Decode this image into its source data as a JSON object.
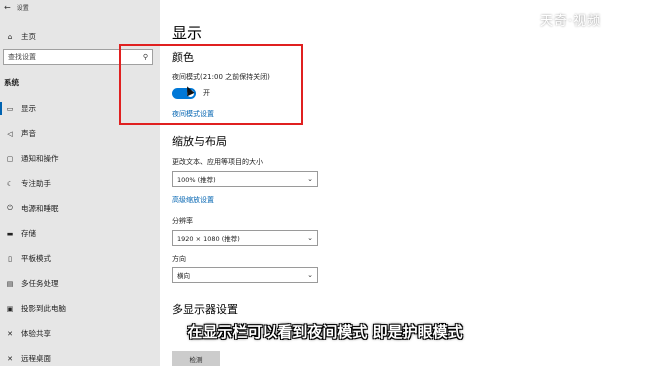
{
  "window": {
    "title": "设置"
  },
  "sidebar": {
    "home_label": "主页",
    "search_placeholder": "查找设置",
    "section_label": "系统",
    "items": [
      {
        "label": "显示",
        "icon": "monitor-icon",
        "active": true
      },
      {
        "label": "声音",
        "icon": "speaker-icon",
        "active": false
      },
      {
        "label": "通知和操作",
        "icon": "notification-icon",
        "active": false
      },
      {
        "label": "专注助手",
        "icon": "moon-icon",
        "active": false
      },
      {
        "label": "电源和睡眠",
        "icon": "power-icon",
        "active": false
      },
      {
        "label": "存储",
        "icon": "storage-icon",
        "active": false
      },
      {
        "label": "平板模式",
        "icon": "tablet-icon",
        "active": false
      },
      {
        "label": "多任务处理",
        "icon": "multitask-icon",
        "active": false
      },
      {
        "label": "投影到此电脑",
        "icon": "project-icon",
        "active": false
      },
      {
        "label": "体验共享",
        "icon": "share-icon",
        "active": false
      },
      {
        "label": "远程桌面",
        "icon": "remote-icon",
        "active": false
      }
    ]
  },
  "main": {
    "page_title": "显示",
    "color_heading": "颜色",
    "night_light_label": "夜间模式(21:00 之前保持关闭)",
    "night_light_toggle": {
      "on": true,
      "state_label": "开"
    },
    "night_light_settings_link": "夜间模式设置",
    "scale_heading": "缩放与布局",
    "scale_label": "更改文本、应用等项目的大小",
    "scale_value": "100% (推荐)",
    "advanced_scaling_link": "高级缩放设置",
    "resolution_label": "分辨率",
    "resolution_value": "1920 × 1080 (推荐)",
    "orientation_label": "方向",
    "orientation_value": "横向",
    "multi_display_heading": "多显示器设置",
    "detect_button": "检测"
  },
  "overlay": {
    "watermark": "天奇·视频",
    "subtitle": "在显示栏可以看到夜间模式 即是护眼模式",
    "highlight_color": "#e02020"
  },
  "colors": {
    "accent": "#0078d7",
    "link": "#0063b1",
    "sidebar_bg": "#e6e6e6"
  }
}
